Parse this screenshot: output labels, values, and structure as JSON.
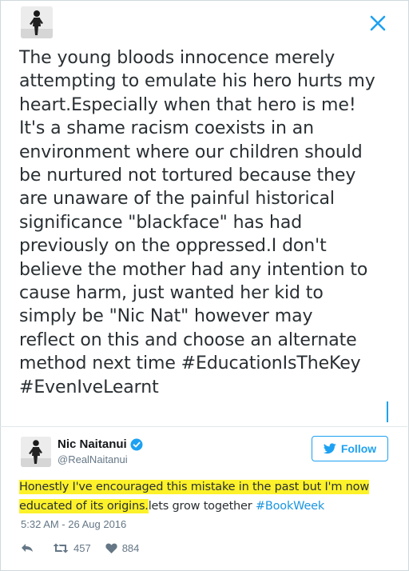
{
  "header": {
    "close_icon": "close-icon",
    "quoted_text": "The young bloods innocence merely\nattempting to emulate his hero hurts my\nheart.Especially when that hero is me!\nIt's a shame racism coexists in an\nenvironment where our children should\nbe nurtured not tortured because they\nare unaware of the painful historical\nsignificance \"blackface\" has had\npreviously on the oppressed.I don't\nbelieve the mother had any intention to\ncause harm, just wanted her kid to\nsimply be \"Nic Nat\" however may\nreflect on this and choose an alternate\nmethod next time #EducationIsTheKey\n#EvenIveLearnt"
  },
  "tweet": {
    "display_name": "Nic Naitanui",
    "handle": "@RealNaitanui",
    "follow_label": "Follow",
    "text_highlighted_1": "Honestly I've encouraged this mistake in the past but I'm now",
    "text_highlighted_2": "educated of its origins.",
    "text_plain": "lets grow together ",
    "hashtag": "#BookWeek",
    "timestamp": "5:32 AM - 26 Aug 2016",
    "retweets": "457",
    "likes": "884"
  },
  "colors": {
    "accent": "#1da1f2",
    "highlight": "#fdf22a",
    "muted": "#657786"
  }
}
